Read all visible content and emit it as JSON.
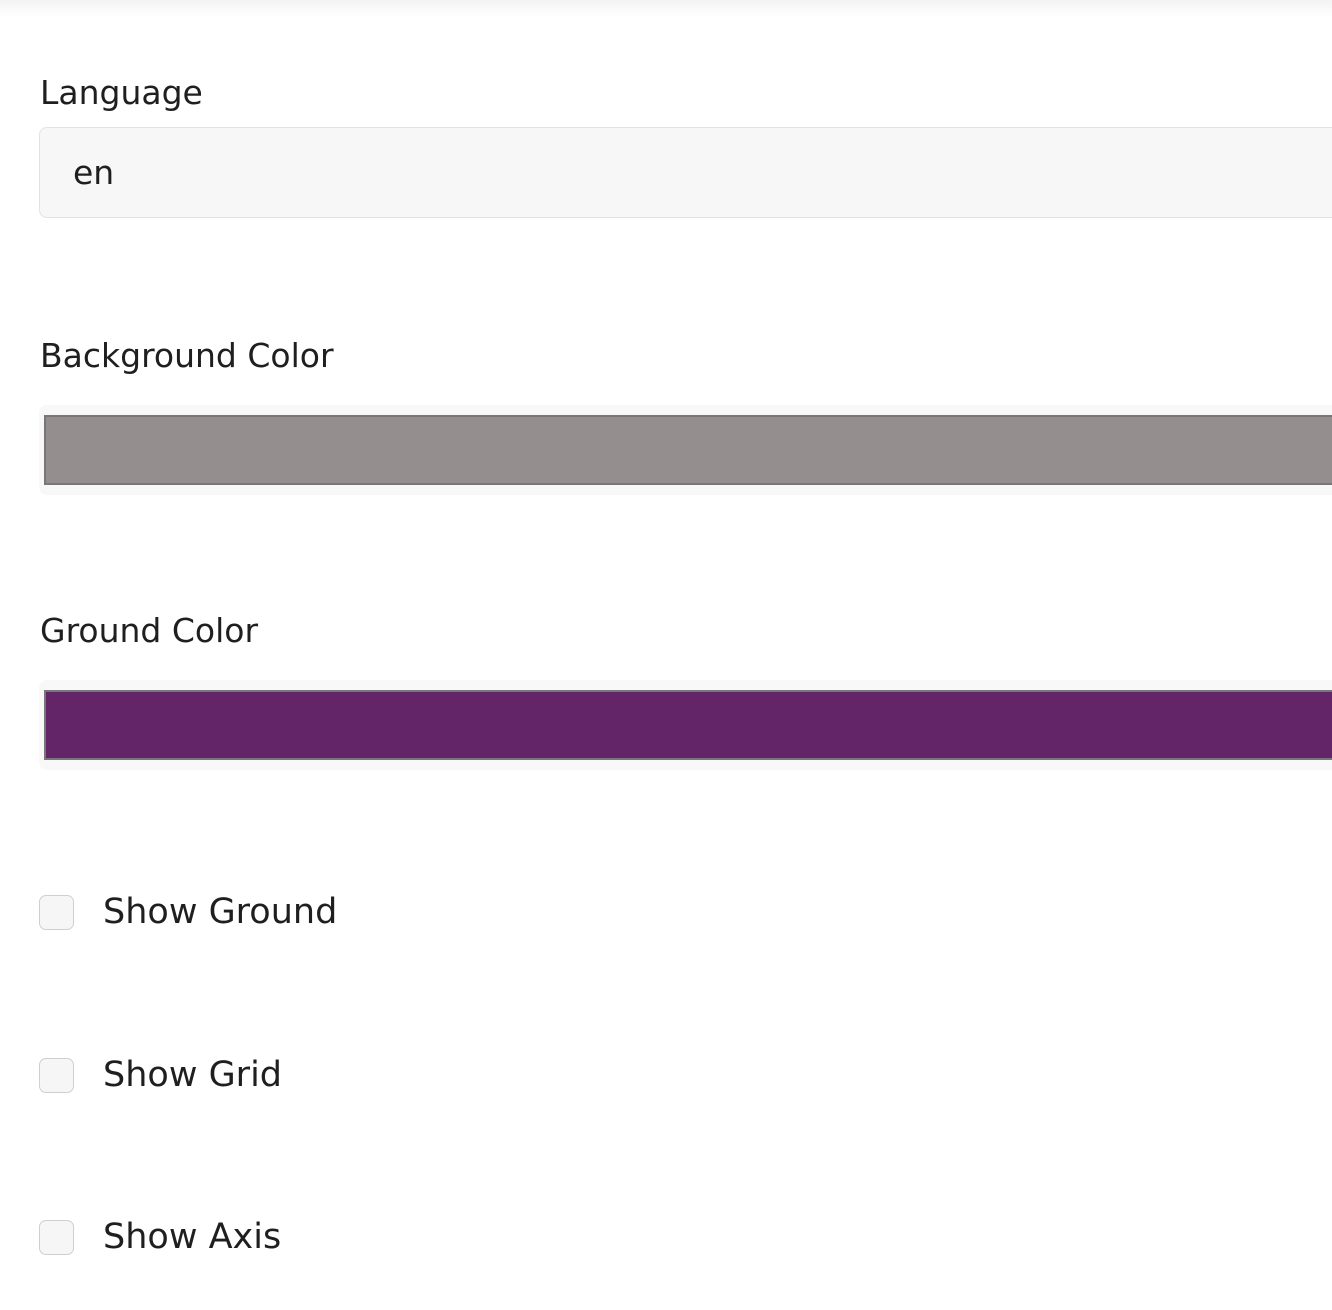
{
  "language": {
    "label": "Language",
    "value": "en"
  },
  "background_color": {
    "label": "Background Color",
    "value": "#958e8e"
  },
  "ground_color": {
    "label": "Ground Color",
    "value": "#632567"
  },
  "options": [
    {
      "label": "Show Ground",
      "checked": false
    },
    {
      "label": "Show Grid",
      "checked": false
    },
    {
      "label": "Show Axis",
      "checked": false
    }
  ]
}
